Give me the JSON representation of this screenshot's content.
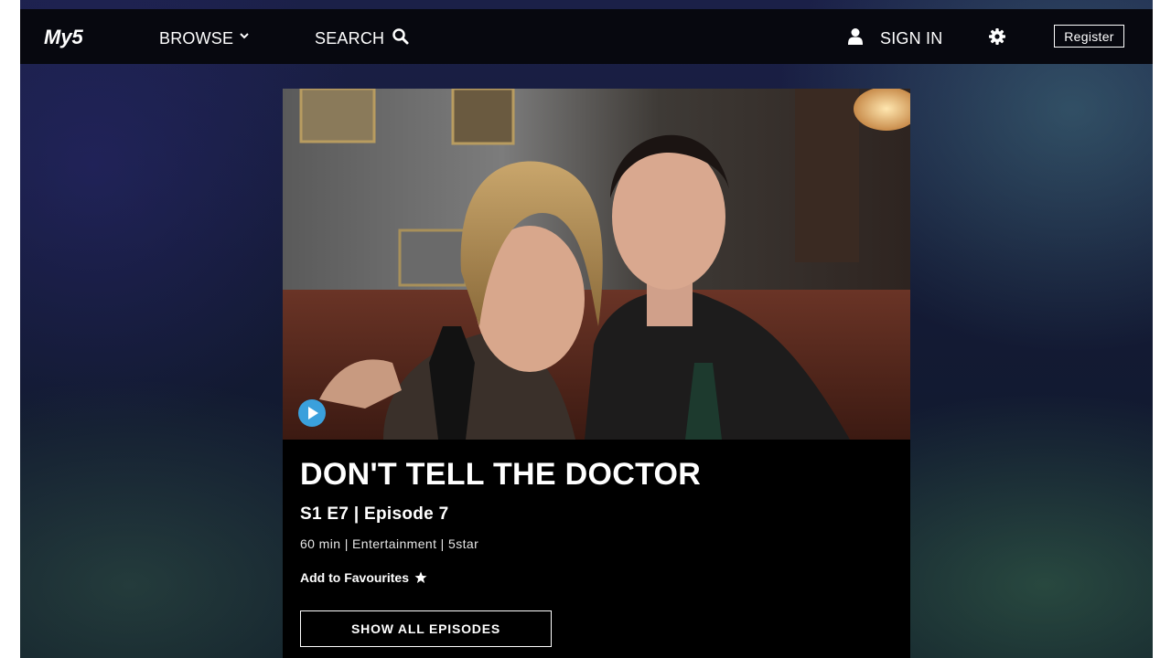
{
  "header": {
    "logo_text": "My5",
    "browse_label": "BROWSE",
    "search_label": "SEARCH",
    "signin_label": "SIGN IN",
    "register_label": "Register"
  },
  "programme": {
    "title": "DON'T TELL THE DOCTOR",
    "episode": "S1 E7 | Episode 7",
    "meta": "60 min | Entertainment | 5star",
    "favourites_label": "Add to Favourites",
    "show_all_label": "SHOW ALL EPISODES"
  },
  "icons": {
    "browse": "chevron-down-icon",
    "search": "search-icon",
    "signin": "user-icon",
    "settings": "gear-icon",
    "favourite": "star-icon",
    "play": "play-icon"
  },
  "colors": {
    "topbar": "#07080f",
    "card": "#000000",
    "play_accent": "#3aa0dc"
  }
}
